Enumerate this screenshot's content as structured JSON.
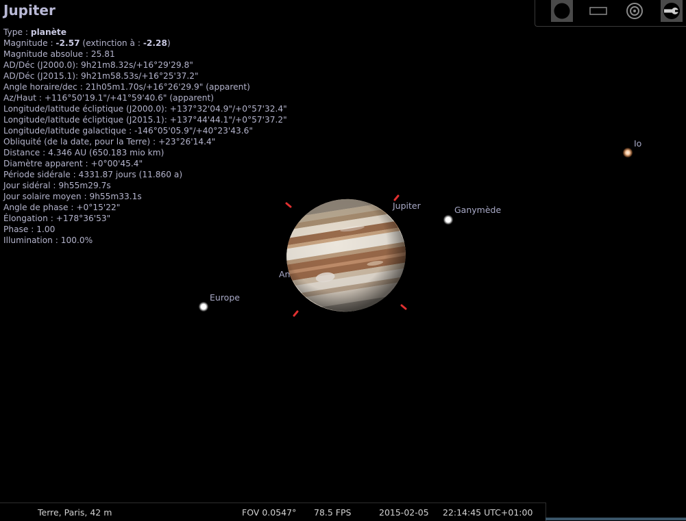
{
  "object": {
    "name": "Jupiter",
    "info_lines": [
      {
        "parts": [
          {
            "t": "Type : "
          },
          {
            "t": "planète",
            "b": true
          }
        ]
      },
      {
        "parts": [
          {
            "t": "Magnitude : "
          },
          {
            "t": "-2.57",
            "b": true
          },
          {
            "t": " (extinction à : "
          },
          {
            "t": "-2.28",
            "b": true
          },
          {
            "t": ")"
          }
        ]
      },
      {
        "parts": [
          {
            "t": "Magnitude absolue : 25.81"
          }
        ]
      },
      {
        "parts": [
          {
            "t": "AD/Déc (J2000.0): 9h21m8.32s/+16°29'29.8\""
          }
        ]
      },
      {
        "parts": [
          {
            "t": "AD/Déc (J2015.1): 9h21m58.53s/+16°25'37.2\""
          }
        ]
      },
      {
        "parts": [
          {
            "t": "Angle horaire/dec : 21h05m1.70s/+16°26'29.9\" (apparent)"
          }
        ]
      },
      {
        "parts": [
          {
            "t": "Az/Haut : +116°50'19.1\"/+41°59'40.6\" (apparent)"
          }
        ]
      },
      {
        "parts": [
          {
            "t": "Longitude/latitude écliptique (J2000.0): +137°32'04.9\"/+0°57'32.4\""
          }
        ]
      },
      {
        "parts": [
          {
            "t": "Longitude/latitude écliptique (J2015.1): +137°44'44.1\"/+0°57'37.2\""
          }
        ]
      },
      {
        "parts": [
          {
            "t": "Longitude/latitude galactique : -146°05'05.9\"/+40°23'43.6\""
          }
        ]
      },
      {
        "parts": [
          {
            "t": "Obliquité (de la date, pour la Terre) : +23°26'14.4\""
          }
        ]
      },
      {
        "parts": [
          {
            "t": "Distance : 4.346 AU (650.183 mio km)"
          }
        ]
      },
      {
        "parts": [
          {
            "t": "Diamètre apparent : +0°00'45.4\""
          }
        ]
      },
      {
        "parts": [
          {
            "t": "Période sidérale : 4331.87 jours (11.860 a)"
          }
        ]
      },
      {
        "parts": [
          {
            "t": "Jour sidéral : 9h55m29.7s"
          }
        ]
      },
      {
        "parts": [
          {
            "t": "Jour solaire moyen : 9h55m33.1s"
          }
        ]
      },
      {
        "parts": [
          {
            "t": "Angle de phase : +0°15'22\""
          }
        ]
      },
      {
        "parts": [
          {
            "t": "Élongation : +178°36'53\""
          }
        ]
      },
      {
        "parts": [
          {
            "t": "Phase : 1.00"
          }
        ]
      },
      {
        "parts": [
          {
            "t": "Illumination : 100.0%"
          }
        ]
      }
    ]
  },
  "sky_labels": {
    "jupiter": "Jupiter",
    "ganymede": "Ganymède",
    "io": "Io",
    "europe": "Europe",
    "hidden_label": "An"
  },
  "toolbar": {
    "icons": [
      "filled-circle-icon",
      "rectangle-icon",
      "concentric-circles-icon",
      "wrench-icon"
    ]
  },
  "status": {
    "location": "Terre, Paris, 42 m",
    "fov": "FOV 0.0547°",
    "fps": "78.5 FPS",
    "date": "2015-02-05",
    "time": "22:14:45 UTC+01:00"
  },
  "colors": {
    "background": "#000000",
    "text": "#b4b4cc",
    "selection_marker": "#e03030",
    "status_accent": "#3a5568"
  }
}
